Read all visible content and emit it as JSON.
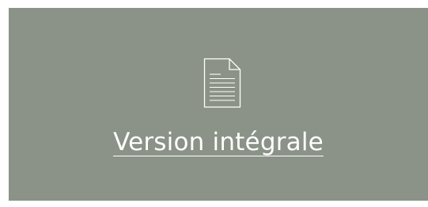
{
  "card": {
    "background_color": "#8b9287",
    "icon": "document-icon",
    "link_label": "Version intégrale",
    "text_color": "#ffffff"
  }
}
